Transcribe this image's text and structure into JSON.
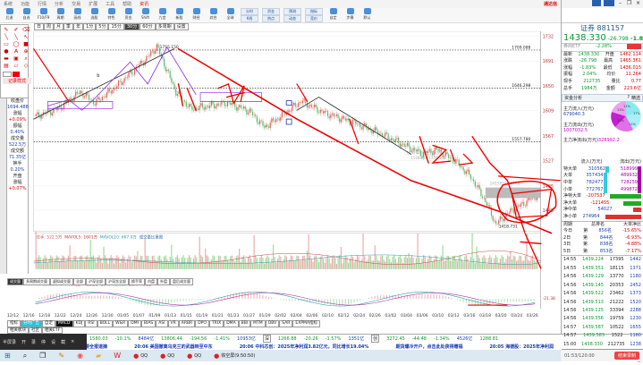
{
  "menu": {
    "items": [
      "系统",
      "功能",
      "行情",
      "分析",
      "交易",
      "扩展",
      "工具",
      "帮助"
    ],
    "highlight": "资讯",
    "brand": "通达信"
  },
  "toolbar": {
    "items": [
      "后退",
      "自选",
      "F10/F9",
      "周期",
      "画线",
      "选股",
      "特色",
      "资金",
      "Shift",
      "九宫",
      "新股",
      "财经",
      "综合",
      "全球"
    ],
    "small": [
      [
        "分时",
        "K线"
      ],
      [
        "资金",
        "热点"
      ],
      [
        "预测",
        "动态"
      ],
      [
        "指标",
        "竞价"
      ]
    ],
    "tail": [
      "自定",
      "步骤",
      "默认"
    ]
  },
  "periods": [
    "日",
    "周",
    "月",
    "季",
    "年",
    "1分",
    "5分",
    "15分",
    "30分",
    "60分",
    "多周期",
    "设置"
  ],
  "active_period": "30分",
  "palette": {
    "label": "记录样式",
    "icons": [
      "pencil",
      "brush",
      "eraser",
      "line",
      "ray",
      "arrow",
      "rect",
      "ellipse",
      "fill-rect",
      "fill-ellipse",
      "text",
      "zoom",
      "bar",
      "screen",
      "magnify",
      "save",
      "open",
      "diamond"
    ]
  },
  "info": {
    "items": [
      [
        "收盘价",
        "1694.488"
      ],
      [
        "涨幅",
        "+0.09%"
      ],
      [
        "振幅",
        "0.40%"
      ],
      [
        "成交量",
        "522.5万"
      ],
      [
        "成交额",
        "71.35亿"
      ],
      [
        "换手",
        "0.20%"
      ],
      [
        "开盘",
        ""
      ],
      [
        "涨幅",
        "+0.07%"
      ]
    ]
  },
  "chart": {
    "y_ticks": [
      "1732",
      "1691",
      "1650",
      "1609",
      "1567",
      "1527",
      "1485",
      "1445"
    ],
    "ylim": [
      1410,
      1740
    ],
    "levels": [
      {
        "label": "1709.088",
        "value": 1709.088
      },
      {
        "label": "1646.298",
        "value": 1646.298
      },
      {
        "label": "1557.780",
        "value": 1557.78
      }
    ],
    "high_label": "1715.150",
    "low_label": "1418.731",
    "range_labels": [
      "1537.440-1537.035",
      "1528.020-1529.305",
      "1453.819-1474.6"
    ],
    "wave_label": "b",
    "price_keypoints": [
      [
        0,
        1600
      ],
      [
        15,
        1612
      ],
      [
        30,
        1640
      ],
      [
        40,
        1622
      ],
      [
        55,
        1650
      ],
      [
        75,
        1695
      ],
      [
        82,
        1715
      ],
      [
        95,
        1640
      ],
      [
        105,
        1612
      ],
      [
        130,
        1622
      ],
      [
        145,
        1608
      ],
      [
        155,
        1582
      ],
      [
        165,
        1598
      ],
      [
        180,
        1625
      ],
      [
        195,
        1606
      ],
      [
        215,
        1590
      ],
      [
        235,
        1570
      ],
      [
        250,
        1552
      ],
      [
        262,
        1538
      ],
      [
        272,
        1545
      ],
      [
        285,
        1525
      ],
      [
        295,
        1500
      ],
      [
        305,
        1460
      ],
      [
        312,
        1422
      ],
      [
        320,
        1440
      ],
      [
        330,
        1455
      ],
      [
        340,
        1470
      ]
    ],
    "header_tabs": [
      "关联",
      "九转",
      "资讯",
      "事件",
      "研报",
      "F10",
      "交易"
    ]
  },
  "volume": {
    "label": "总手: 522.5万",
    "mavol5": "MAVOL5: 1601万",
    "mavol10": "MAVOL10: 667.0万",
    "extra": "成交量比重图"
  },
  "vol_tabs": [
    "成交量",
    "多周期成交量",
    "虚拟成交量",
    "全部",
    "沪深全部",
    "沪深含全部",
    "换手率",
    "内盘",
    "外盘",
    "盘后成交量"
  ],
  "macd": {
    "label": "MACD(12,26,9)",
    "macd": "MACD: +13.55",
    "diff": "DIFF: +14.09",
    "dea": "DEA: +6.22",
    "axis_label": "-21.38"
  },
  "x_dates": [
    "12/12",
    "12/16",
    "12/18",
    "12/22",
    "12/24",
    "12/26",
    "12/30",
    "01/05",
    "01/07",
    "01/09",
    "01/13",
    "01/15",
    "01/19",
    "01/21",
    "01/23",
    "01/27",
    "01/29",
    "02/02",
    "02/04",
    "02/06",
    "02/10",
    "02/12",
    "02/24",
    "02/26",
    "03/02",
    "03/04",
    "03/06",
    "03/10",
    "03/12",
    "03/16",
    "03/18",
    "03/20",
    "03/24",
    "03/26"
  ],
  "ind_tabs": [
    "指标",
    "分时广告",
    "自定",
    "MACD",
    "KDJ",
    "RSI",
    "BOLL",
    "W&R",
    "DMI",
    "BIAS",
    "ASI",
    "VR",
    "ARBR",
    "DPO",
    "TRIX",
    "DMA",
    "BBI",
    "MTM",
    "OBV",
    "SAR",
    "EXPMA指标"
  ],
  "sub_tabs": [
    "相关板块",
    "社区",
    "相关ETF"
  ],
  "index_ticker": [
    [
      "1580.03",
      "-10.1%"
    ],
    [
      "8484亿",
      "13806.44",
      "-194.56",
      "-1.41%",
      "10953亿"
    ],
    [
      "1266.88",
      "-20.26",
      "-1.57%",
      "1351亿"
    ],
    [
      "3272.45",
      "-44.48",
      "-1.34%",
      "4526亿"
    ],
    [
      "1288.81"
    ]
  ],
  "index_names": [
    "深",
    "创"
  ],
  "news": [
    "要全报道摘",
    "20:06 美国撤离乌克兰的武器转至中东",
    "20:06 中科芯创：2025年净利润3.82亿元，同比增长19.04%",
    "期货爆冷开户，点击此处获得赠福",
    "20:05 海德股：2025年净利润"
  ],
  "recorder": {
    "title": "半屏录",
    "controls": [
      "开",
      "录",
      "停",
      "设",
      "截"
    ],
    "time": "01:53",
    "total": "120:00",
    "stop_label": "结束录制"
  },
  "taskbar": {
    "apps": [
      "QQ",
      "QQ",
      "QQ",
      "铁空屏(9:50:50)"
    ]
  },
  "quote": {
    "name": "证券",
    "code": "881157",
    "price": "1438.330",
    "change": "-26.798",
    "pct": "-1.83%",
    "etf": "券商ETF",
    "etf_pct": "-2.28%",
    "rows": [
      [
        "最新",
        "1438.330",
        "开盘",
        "1462.114"
      ],
      [
        "涨跌",
        "-26.798",
        "最高",
        "1465.361"
      ],
      [
        "涨幅",
        "-1.83%",
        "最低",
        "1436.015"
      ],
      [
        "振幅",
        "2.04%",
        "均价",
        "11.264"
      ],
      [
        "现手",
        "212735",
        "量比",
        "0.77"
      ],
      [
        "总手",
        "1984万",
        "金额",
        "223.6亿"
      ]
    ],
    "tabs": [
      "资金分析",
      "?",
      "精选"
    ],
    "inflow_label": "主力流入(万元)",
    "inflow": "679040.3",
    "outflow_label": "主力流出(万元)",
    "outflow": "1007032.5",
    "net_label": "主力净流出(万元)",
    "net": "328992.2",
    "pie_labels": [
      "11%",
      "17%",
      "11%",
      "17%",
      "11%"
    ],
    "flow_head": [
      "流入(万元)",
      "流出(万元)"
    ],
    "flow_rows": [
      [
        "特大单",
        "310562",
        "518999"
      ],
      [
        "大单",
        "357434",
        "489932"
      ],
      [
        "中单",
        "782477",
        "728259"
      ],
      [
        "小单",
        "772767",
        "499872"
      ]
    ],
    "net_rows": [
      [
        "净特大单",
        "-207537"
      ],
      [
        "净大单",
        "-121455"
      ],
      [
        "净中单",
        "54027"
      ],
      [
        "净小单",
        "274964"
      ]
    ],
    "rank_head": [
      "周期",
      "总排名",
      "大单净比"
    ],
    "rank_rows": [
      [
        "今日",
        "第",
        "856名",
        "-15.65%"
      ],
      [
        "2日",
        "第",
        "844名",
        "-6.93%"
      ],
      [
        "3日",
        "第",
        "838名",
        "-4.88%"
      ],
      [
        "5日",
        "第",
        "853名",
        "-7.17%"
      ]
    ],
    "ticks": [
      [
        "14:55",
        "1439.224",
        "17395",
        "1442"
      ],
      [
        "14:55",
        "1439.351",
        "18115",
        "1371"
      ],
      [
        "14:56",
        "1439.129",
        "13770",
        "1180"
      ],
      [
        "14:56",
        "1439.145",
        "20353",
        "2452"
      ],
      [
        "14:56",
        "1439.522",
        "23462",
        "1373"
      ],
      [
        "14:56",
        "1439.513",
        "21222",
        "1520"
      ],
      [
        "14:56",
        "1439.125",
        "33394",
        "2288"
      ],
      [
        "14:56",
        "1439.356",
        "19759",
        "1230"
      ],
      [
        "14:57",
        "1439.587",
        "10522",
        "1655"
      ],
      [
        "14:57",
        "1439.583",
        "1522",
        "1160"
      ],
      [
        "15:00",
        "1438.330",
        "212735",
        "1238"
      ]
    ],
    "bottom_tabs": [
      "笔",
      "分",
      "筹",
      "价"
    ],
    "bottom_vals": [
      "-26.80",
      "-2.82%",
      "555亿"
    ]
  }
}
